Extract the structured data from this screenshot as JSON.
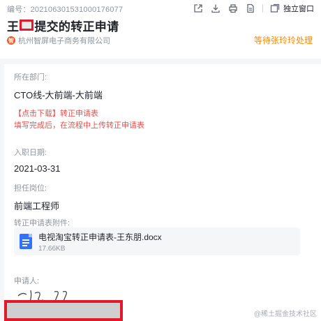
{
  "header": {
    "serial": "编号：202106301531000176077",
    "title_prefix": "王",
    "title_suffix": "提交的转正申请",
    "company": "杭州智屏电子商务有限公司",
    "pending_status": "等待张玲玲处理",
    "toolbar": {
      "icons": [
        "share-icon",
        "download-icon",
        "print-icon",
        "document-icon",
        "window-icon"
      ],
      "standalone_label": "独立窗口"
    }
  },
  "form": {
    "department": {
      "label": "所在部门:",
      "value": "CTO线-大前端-大前端"
    },
    "download_note": {
      "line1": "【点击下载】转正申请表",
      "line2": "填写完成后，在流程中上传转正申请表"
    },
    "hire_date": {
      "label": "入职日期:",
      "value": "2021-03-31"
    },
    "position": {
      "label": "担任岗位:",
      "value": "前端工程师"
    },
    "attachment": {
      "label": "转正申请表附件:",
      "file_name": "电视淘宝转正申请表-王东朋.docx",
      "file_size": "17.66KB"
    },
    "applicant": {
      "label": "申请人:"
    }
  },
  "watermark": "@稀土掘金技术社区",
  "colors": {
    "accent_blue": "#3370ff",
    "warning_orange": "#ff8800",
    "note_red": "#f54a45",
    "redaction_red": "#e0192d"
  }
}
